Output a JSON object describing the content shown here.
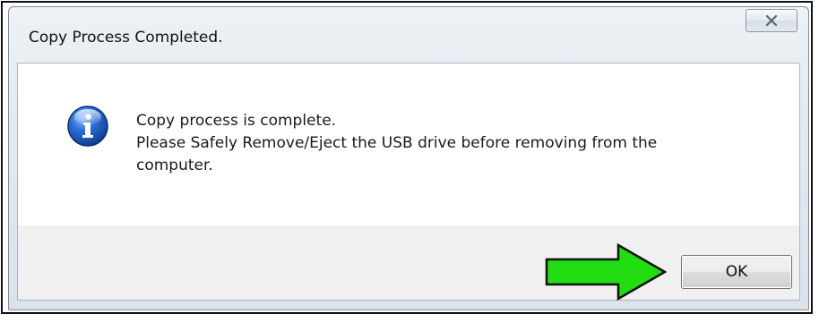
{
  "window": {
    "title": "Copy Process Completed."
  },
  "icons": {
    "close": "close-icon",
    "info": "info-icon",
    "pointer": "green-arrow-icon"
  },
  "message": {
    "line1": "Copy process is complete.",
    "line2": "Please Safely Remove/Eject the USB drive before removing from the",
    "line3": "computer."
  },
  "buttons": {
    "ok_label": "OK"
  },
  "colors": {
    "arrow_fill": "#22dd11",
    "info_icon_blue": "#1f55b5",
    "dialog_footer": "#f0f0f0"
  }
}
